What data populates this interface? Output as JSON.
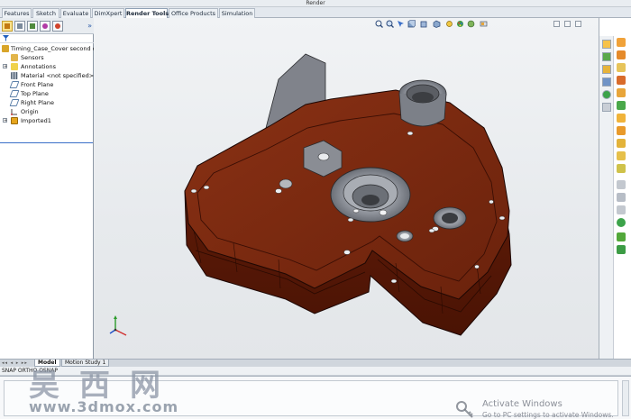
{
  "window": {
    "title": "Render"
  },
  "command_tabs": [
    {
      "label": "Features"
    },
    {
      "label": "Sketch"
    },
    {
      "label": "Evaluate"
    },
    {
      "label": "DimXpert"
    },
    {
      "label": "Render Tools"
    },
    {
      "label": "Office Products"
    },
    {
      "label": "Simulation"
    }
  ],
  "active_tab": "Render Tools",
  "feature_tree": {
    "root": "Timing_Case_Cover second design",
    "items": [
      {
        "label": "Sensors",
        "icon": "sensors-icon"
      },
      {
        "label": "Annotations",
        "icon": "annotations-icon",
        "expandable": "+"
      },
      {
        "label": "Material <not specified>",
        "icon": "material-icon"
      },
      {
        "label": "Front Plane",
        "icon": "plane-icon"
      },
      {
        "label": "Top Plane",
        "icon": "plane-icon"
      },
      {
        "label": "Right Plane",
        "icon": "plane-icon"
      },
      {
        "label": "Origin",
        "icon": "origin-icon"
      },
      {
        "label": "Imported1",
        "icon": "imported-body-icon",
        "expandable": "+"
      }
    ],
    "expand_glyph": "»"
  },
  "bottom_tabs": [
    {
      "label": "Model"
    },
    {
      "label": "Motion Study 1"
    }
  ],
  "active_bottom_tab": "Model",
  "status_bar": {
    "text": "SNAP  ORTHO  OSNAP"
  },
  "watermark": {
    "chinese": "吴西网",
    "url": "www.3dmox.com"
  },
  "activation_notice": {
    "title": "Activate Windows",
    "subtitle": "Go to PC settings to activate Windows."
  },
  "colors": {
    "model_face": "#7a2a12",
    "model_shadow": "#4e1606",
    "model_edge": "#1d0703",
    "boss_grey": "#8a8e96",
    "accent_blue": "#3a6fc8"
  }
}
